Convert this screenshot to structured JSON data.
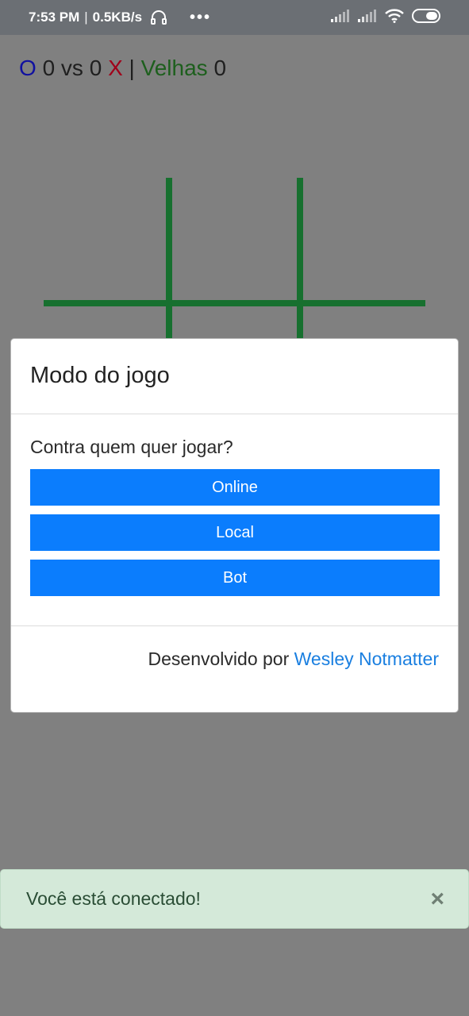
{
  "status_bar": {
    "time": "7:53 PM",
    "separator": "|",
    "network_speed": "0.5KB/s",
    "more": "•••",
    "icons": [
      "headset-icon",
      "signal-icon",
      "signal-icon",
      "wifi-icon",
      "battery-icon"
    ]
  },
  "scoreboard": {
    "o_label": "O",
    "o_score": "0",
    "vs": "vs",
    "x_score": "0",
    "x_label": "X",
    "separator": "|",
    "draws_label": "Velhas",
    "draws_score": "0",
    "colors": {
      "o": "#1010a0",
      "x": "#a0001a",
      "draws": "#1d5f1d"
    }
  },
  "board": {
    "line_color": "#17702f"
  },
  "dialog": {
    "title": "Modo do jogo",
    "question": "Contra quem quer jogar?",
    "buttons": [
      {
        "label": "Online"
      },
      {
        "label": "Local"
      },
      {
        "label": "Bot"
      }
    ],
    "footer_prefix": "Desenvolvido por",
    "footer_link": "Wesley Notmatter",
    "button_color": "#0b7dfd"
  },
  "toast": {
    "message": "Você está conectado!",
    "close": "×"
  }
}
